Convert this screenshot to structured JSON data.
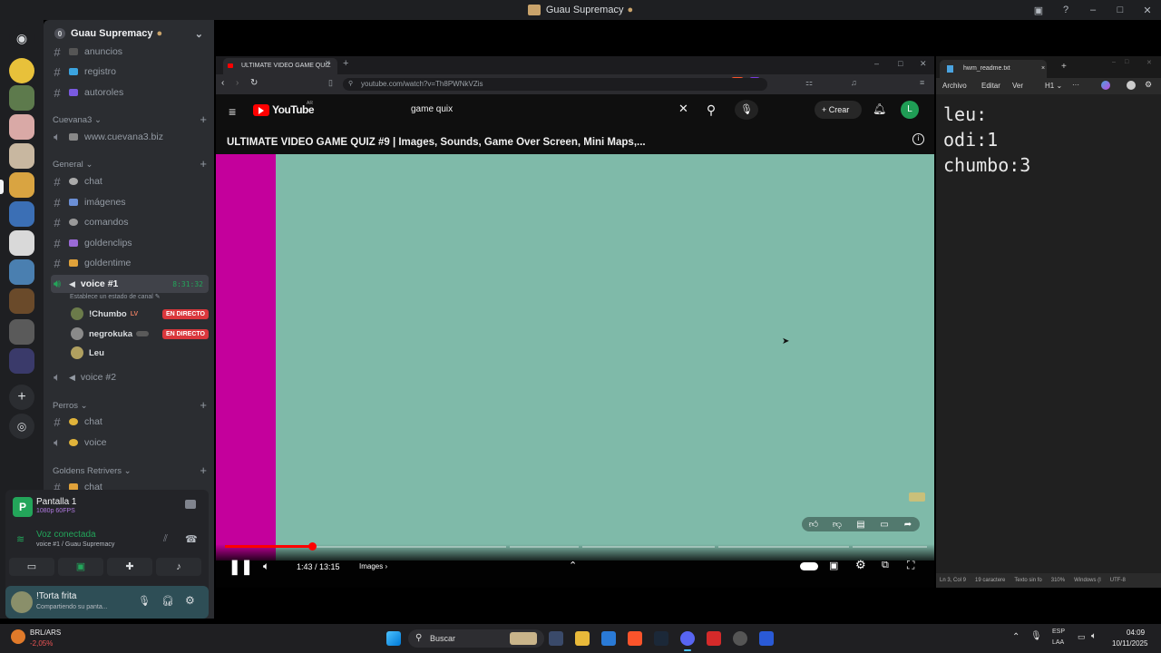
{
  "discord_titlebar": {
    "title": "Guau Supremacy"
  },
  "server": {
    "name": "Guau Supremacy",
    "channels_top": [
      {
        "name": "anuncios",
        "type": "text"
      },
      {
        "name": "registro",
        "type": "text"
      },
      {
        "name": "autoroles",
        "type": "text"
      }
    ],
    "categories": [
      {
        "name": "Cuevana3",
        "channels": [
          {
            "name": "www.cuevana3.biz",
            "type": "voice"
          }
        ]
      },
      {
        "name": "General",
        "channels": [
          {
            "name": "chat",
            "type": "text"
          },
          {
            "name": "imágenes",
            "type": "text"
          },
          {
            "name": "comandos",
            "type": "text"
          },
          {
            "name": "goldenclips",
            "type": "text"
          },
          {
            "name": "goldentime",
            "type": "text"
          }
        ]
      },
      {
        "name": "Perros",
        "channels": [
          {
            "name": "chat",
            "type": "text"
          },
          {
            "name": "voice",
            "type": "voice"
          }
        ]
      },
      {
        "name": "Goldens Retrivers",
        "channels": [
          {
            "name": "chat",
            "type": "text"
          }
        ]
      }
    ],
    "active_voice": {
      "name": "voice #1",
      "timer": "8:31:32",
      "status_hint": "Establece un estado de canal",
      "members": [
        {
          "name": "!Chumbo",
          "tag": "LV",
          "live": "EN DIRECTO"
        },
        {
          "name": "negrokuka",
          "tag": "",
          "live": "EN DIRECTO"
        },
        {
          "name": "Leu",
          "tag": "",
          "live": ""
        }
      ]
    },
    "voice2": "voice #2"
  },
  "voice_panel": {
    "stream_title": "Pantalla 1",
    "stream_quality": "1080p 60FPS",
    "status": "Voz conectada",
    "location": "voice #1 / Guau Supremacy"
  },
  "user": {
    "name": "!Torta frita",
    "status": "Compartiendo su panta..."
  },
  "browser": {
    "tab_title": "ULTIMATE VIDEO GAME QUIZ",
    "url": "youtube.com/watch?v=Th8PWNkVZis",
    "yt_logo": "YouTube",
    "yt_country": "AR",
    "search_query": "game quix",
    "create_label": "Crear",
    "avatar_letter": "L",
    "video_title": "ULTIMATE VIDEO GAME QUIZ #9 | Images, Sounds, Game Over Screen, Mini Maps,...",
    "time": "1:43 / 13:15",
    "chapter": "Images",
    "progress_fraction": 0.13
  },
  "notepad": {
    "tab_title": "hwm_readme.txt",
    "menu": [
      "Archivo",
      "Editar",
      "Ver"
    ],
    "heading_menu": "H1",
    "text": "leu:\nodi:1\nchumbo:3",
    "status": [
      "Ln 3, Col 9",
      "19 caractere",
      "Texto sin fo",
      "310%",
      "Windows (I",
      "UTF-8"
    ]
  },
  "taskbar": {
    "ticker_symbol": "BRL/ARS",
    "ticker_change": "-2,05%",
    "search_label": "Buscar",
    "lang": "ESP",
    "lang2": "LAA",
    "time": "04:09",
    "date": "10/11/2025"
  },
  "colors": {
    "video_bg": "#7fbaa9",
    "video_left_bar": "#c4009c",
    "live_badge": "#da373c",
    "progress": "#ff0000"
  }
}
